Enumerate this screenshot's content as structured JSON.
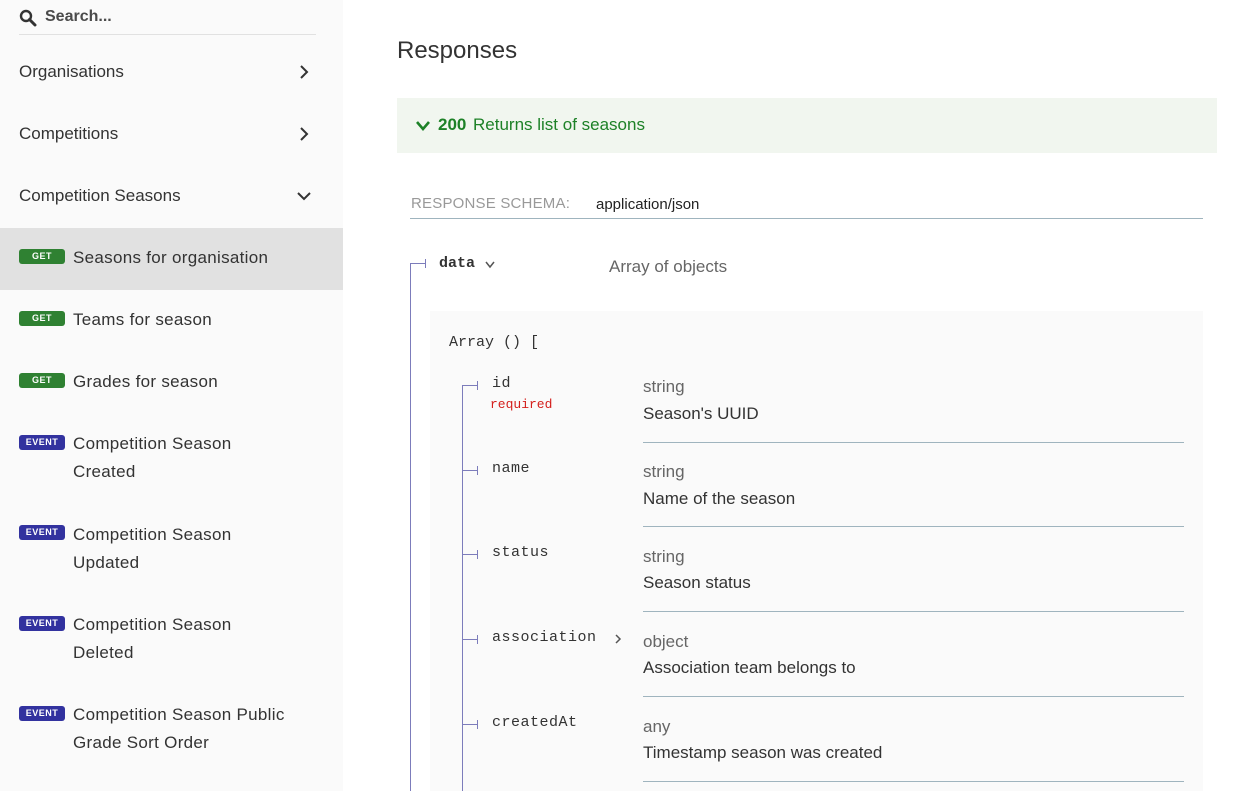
{
  "sidebar": {
    "search": {
      "placeholder": "Search..."
    },
    "groups": [
      {
        "label": "Organisations",
        "expanded": false
      },
      {
        "label": "Competitions",
        "expanded": false
      },
      {
        "label": "Competition Seasons",
        "expanded": true
      }
    ],
    "items": [
      {
        "method": "GET",
        "label": "Seasons for organisation",
        "active": true
      },
      {
        "method": "GET",
        "label": "Teams for season",
        "active": false
      },
      {
        "method": "GET",
        "label": "Grades for season",
        "active": false
      },
      {
        "method": "EVENT",
        "label": "Competition Season Created",
        "active": false
      },
      {
        "method": "EVENT",
        "label": "Competition Season Updated",
        "active": false
      },
      {
        "method": "EVENT",
        "label": "Competition Season Deleted",
        "active": false
      },
      {
        "method": "EVENT",
        "label": "Competition Season Public Grade Sort Order",
        "active": false
      }
    ]
  },
  "main": {
    "title": "Responses",
    "response": {
      "code": "200",
      "description": "Returns list of seasons"
    },
    "schema": {
      "label": "RESPONSE SCHEMA:",
      "content_type": "application/json"
    },
    "data_field": {
      "name": "data",
      "type": "Array of objects"
    },
    "array_label": "Array () [",
    "required_label": "required",
    "fields": [
      {
        "name": "id",
        "type": "string",
        "description": "Season's UUID",
        "required": true,
        "expandable": false
      },
      {
        "name": "name",
        "type": "string",
        "description": "Name of the season",
        "required": false,
        "expandable": false
      },
      {
        "name": "status",
        "type": "string",
        "description": "Season status",
        "required": false,
        "expandable": false
      },
      {
        "name": "association",
        "type": "object",
        "description": "Association team belongs to",
        "required": false,
        "expandable": true
      },
      {
        "name": "createdAt",
        "type": "any",
        "description": "Timestamp season was created",
        "required": false,
        "expandable": false
      }
    ]
  },
  "colors": {
    "get_badge": "#2f8132",
    "event_badge": "#32329f",
    "success_text": "#1d8127",
    "success_bg": "#f1f6ef",
    "required_text": "#d41f1c",
    "tree_line": "#7c7cbb"
  }
}
